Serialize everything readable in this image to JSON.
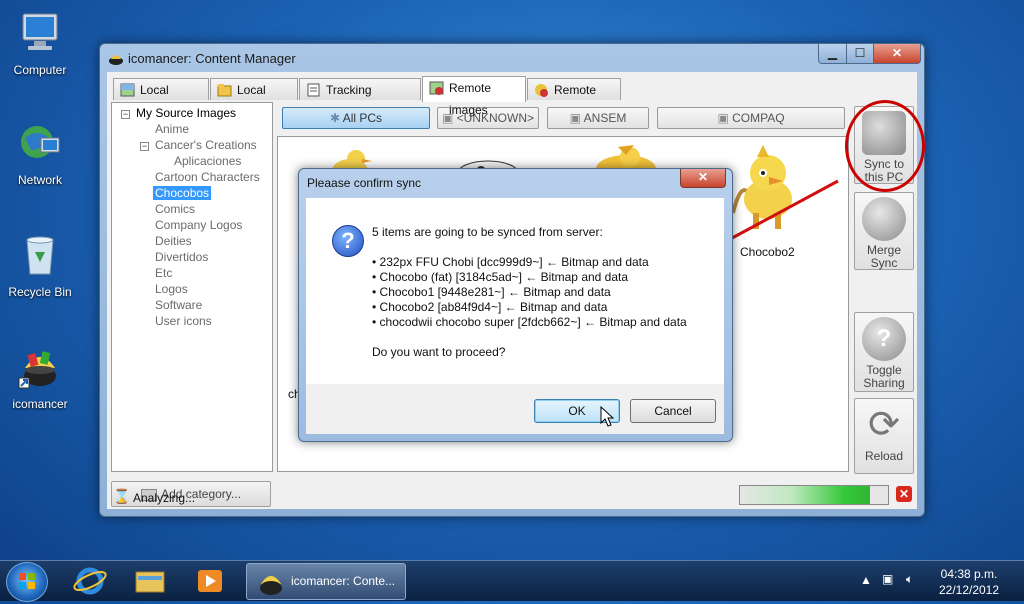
{
  "desktop": {
    "icons": [
      {
        "label": "Computer"
      },
      {
        "label": "Network"
      },
      {
        "label": "Recycle Bin"
      },
      {
        "label": "icomancer"
      }
    ]
  },
  "window": {
    "title": "icomancer: Content Manager",
    "tabs": [
      {
        "label": "Local images"
      },
      {
        "label": "Local icons"
      },
      {
        "label": "Tracking Database"
      },
      {
        "label": "Remote images"
      },
      {
        "label": "Remote Icons"
      }
    ],
    "active_tab": "Remote images",
    "tree": {
      "root": "My Source Images",
      "items": [
        "Anime",
        "Cancer's Creations",
        "Aplicaciones",
        "Cartoon Characters",
        "Chocobos",
        "Comics",
        "Company Logos",
        "Deities",
        "Divertidos",
        "Etc",
        "Logos",
        "Software",
        "User icons"
      ],
      "selected": "Chocobos"
    },
    "add_category": "Add category...",
    "pcs": [
      "All PCs",
      "<UNKNOWN>",
      "ANSEM",
      "COMPAQ"
    ],
    "image_labels": {
      "visible_label": "Chocobo2",
      "partial_label": "ch"
    },
    "side_buttons": {
      "sync": "Sync to this PC",
      "merge": "Merge Sync",
      "toggle": "Toggle Sharing",
      "reload": "Reload"
    },
    "status": "Analyzing...",
    "progress": 0.88,
    "stop_label": "✕"
  },
  "dialog": {
    "title": "Pleaase confirm sync",
    "intro": "5 items are going to be synced from server:",
    "items": [
      "• 232px FFU Chobi [dcc999d9~] ← Bitmap and data",
      "• Chocobo (fat) [3184c5ad~] ← Bitmap and data",
      "• Chocobo1 [9448e281~] ← Bitmap and data",
      "• Chocobo2 [ab84f9d4~] ← Bitmap and data",
      "• chocodwii chocobo super [2fdcb662~] ← Bitmap and data"
    ],
    "question": "Do you want to proceed?",
    "ok": "OK",
    "cancel": "Cancel",
    "close": "✕"
  },
  "taskbar": {
    "task_label": "icomancer: Conte...",
    "time": "04:38 p.m.",
    "date": "22/12/2012"
  },
  "colors": {
    "annotation": "#cc0000",
    "selection": "#3399ff"
  }
}
